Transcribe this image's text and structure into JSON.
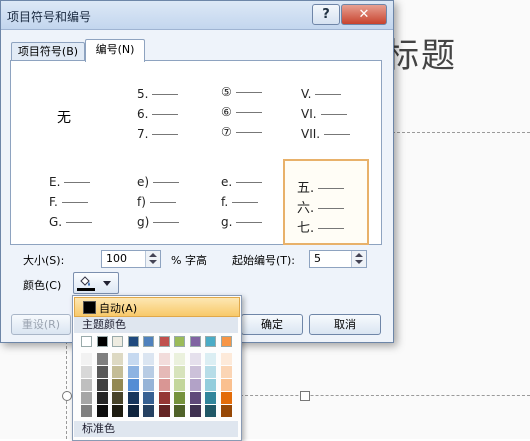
{
  "slide": {
    "title_fragment": "标题"
  },
  "dialog": {
    "title": "项目符号和编号",
    "help_label": "?",
    "close_label": "✕",
    "tabs": [
      {
        "label": "项目符号(B)"
      },
      {
        "label": "编号(N)"
      }
    ],
    "gallery": {
      "none_label": "无",
      "cells": [
        [
          "5.",
          "6.",
          "7."
        ],
        [
          "⑤",
          "⑥",
          "⑦"
        ],
        [
          "V.",
          "VI.",
          "VII."
        ],
        [
          "E.",
          "F.",
          "G."
        ],
        [
          "e)",
          "f)",
          "g)"
        ],
        [
          "e.",
          "f.",
          "g."
        ],
        [
          "五.",
          "六.",
          "七."
        ]
      ]
    },
    "size_label": "大小(S):",
    "size_value": "100",
    "size_unit": "% 字高",
    "start_label": "起始编号(T):",
    "start_value": "5",
    "color_label": "颜色(C)",
    "reset_label": "重设(R)",
    "ok_label": "确定",
    "cancel_label": "取消"
  },
  "color_menu": {
    "auto_label": "自动(A)",
    "theme_label": "主题颜色",
    "standard_label": "标准色",
    "theme_top": [
      "#ffffff",
      "#000000",
      "#eeece1",
      "#1f497d",
      "#4f81bd",
      "#c0504d",
      "#9bbb59",
      "#8064a2",
      "#4bacc6",
      "#f79646"
    ],
    "theme_shades": [
      [
        "#f2f2f2",
        "#7f7f7f",
        "#ddd9c3",
        "#c6d9f0",
        "#dbe5f1",
        "#f2dcdb",
        "#ebf1dd",
        "#e5e0ec",
        "#dbeef3",
        "#fdeada"
      ],
      [
        "#d8d8d8",
        "#595959",
        "#c4bd97",
        "#8db3e2",
        "#b8cce4",
        "#e5b9b7",
        "#d7e3bc",
        "#ccc1d9",
        "#b7dde8",
        "#fbd5b5"
      ],
      [
        "#bfbfbf",
        "#3f3f3f",
        "#938953",
        "#548dd4",
        "#95b3d7",
        "#d99694",
        "#c3d69b",
        "#b2a2c7",
        "#92cddc",
        "#fac08f"
      ],
      [
        "#a5a5a5",
        "#262626",
        "#494429",
        "#17365d",
        "#366092",
        "#953734",
        "#76923c",
        "#5f497a",
        "#31859b",
        "#e36c09"
      ],
      [
        "#7f7f7f",
        "#0c0c0c",
        "#1d1b10",
        "#0f243e",
        "#244061",
        "#632423",
        "#4f6128",
        "#3f3151",
        "#205867",
        "#974806"
      ]
    ]
  }
}
